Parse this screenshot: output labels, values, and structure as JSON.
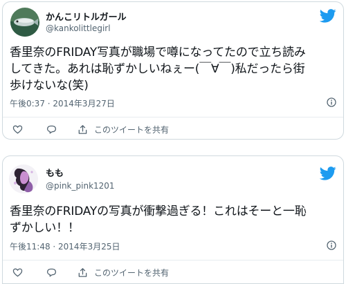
{
  "tweets": [
    {
      "display_name": "かんこリトルガール",
      "handle": "@kankolittlegirl",
      "text_lines": [
        "香里奈のFRIDAY写真が職場で噂になってたので立ち読み",
        "してきた。あれは恥ずかしいねぇー(￣∀￣)私だったら街",
        "歩けないな(笑)"
      ],
      "timestamp": "午後0:37 · 2014年3月27日",
      "share_label": "このツイートを共有"
    },
    {
      "display_name": "もも",
      "handle": "@pink_pink1201",
      "text_lines": [
        "香里奈のFRIDAYの写真が衝撃過ぎる！これはそーと一恥",
        "ずかしい！！"
      ],
      "timestamp": "午後11:48 · 2014年3月25日",
      "share_label": "このツイートを共有"
    }
  ],
  "icons": {
    "brand": "twitter-bird-icon",
    "info": "info-icon",
    "like": "heart-icon",
    "reply": "comment-icon",
    "share": "share-icon"
  },
  "colors": {
    "twitter_blue": "#1d9bf0",
    "secondary_text": "#536471",
    "border": "#cfd9de"
  }
}
